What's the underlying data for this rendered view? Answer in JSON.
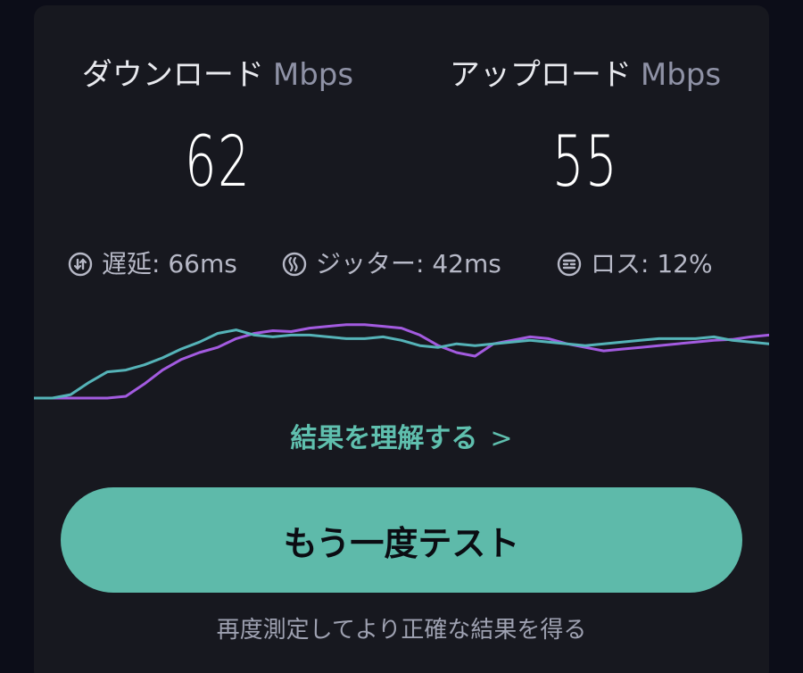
{
  "download": {
    "label": "ダウンロード",
    "unit": "Mbps",
    "value": "62"
  },
  "upload": {
    "label": "アップロード",
    "unit": "Mbps",
    "value": "55"
  },
  "metrics": {
    "latency": {
      "icon": "latency-icon",
      "text": "遅延: 66ms"
    },
    "jitter": {
      "icon": "jitter-icon",
      "text": "ジッター: 42ms"
    },
    "loss": {
      "icon": "packet-loss-icon",
      "text": "ロス: 12%"
    }
  },
  "chart_data": {
    "type": "line",
    "x": [
      0,
      1,
      2,
      3,
      4,
      5,
      6,
      7,
      8,
      9,
      10,
      11,
      12,
      13,
      14,
      15,
      16,
      17,
      18,
      19,
      20,
      21,
      22,
      23,
      24,
      25,
      26,
      27,
      28,
      29,
      30,
      31,
      32,
      33,
      34,
      35,
      36,
      37,
      38,
      39,
      40
    ],
    "series": [
      {
        "color": "#a35be0",
        "values": [
          0,
          0,
          0,
          0,
          0,
          2,
          16,
          32,
          44,
          52,
          58,
          68,
          74,
          77,
          76,
          80,
          82,
          84,
          84,
          82,
          80,
          72,
          60,
          52,
          48,
          62,
          66,
          70,
          68,
          62,
          58,
          54,
          56,
          58,
          60,
          62,
          64,
          66,
          67,
          70,
          72
        ]
      },
      {
        "color": "#55b3b8",
        "values": [
          0,
          0,
          4,
          18,
          30,
          32,
          38,
          46,
          56,
          64,
          74,
          78,
          72,
          70,
          72,
          72,
          70,
          68,
          68,
          70,
          66,
          60,
          58,
          62,
          60,
          62,
          64,
          66,
          64,
          62,
          60,
          62,
          64,
          66,
          68,
          68,
          68,
          70,
          66,
          64,
          62
        ]
      }
    ],
    "ylim": [
      0,
      100
    ]
  },
  "learn_more": {
    "label": "結果を理解する",
    "chevron": ">"
  },
  "retest_button": {
    "label": "もう一度テスト"
  },
  "hint": {
    "text": "再度測定してより正確な結果を得る"
  },
  "colors": {
    "background": "#0c0d18",
    "card": "#17181f",
    "accent": "#5ebaaa",
    "download_line": "#a35be0",
    "upload_line": "#55b3b8"
  }
}
